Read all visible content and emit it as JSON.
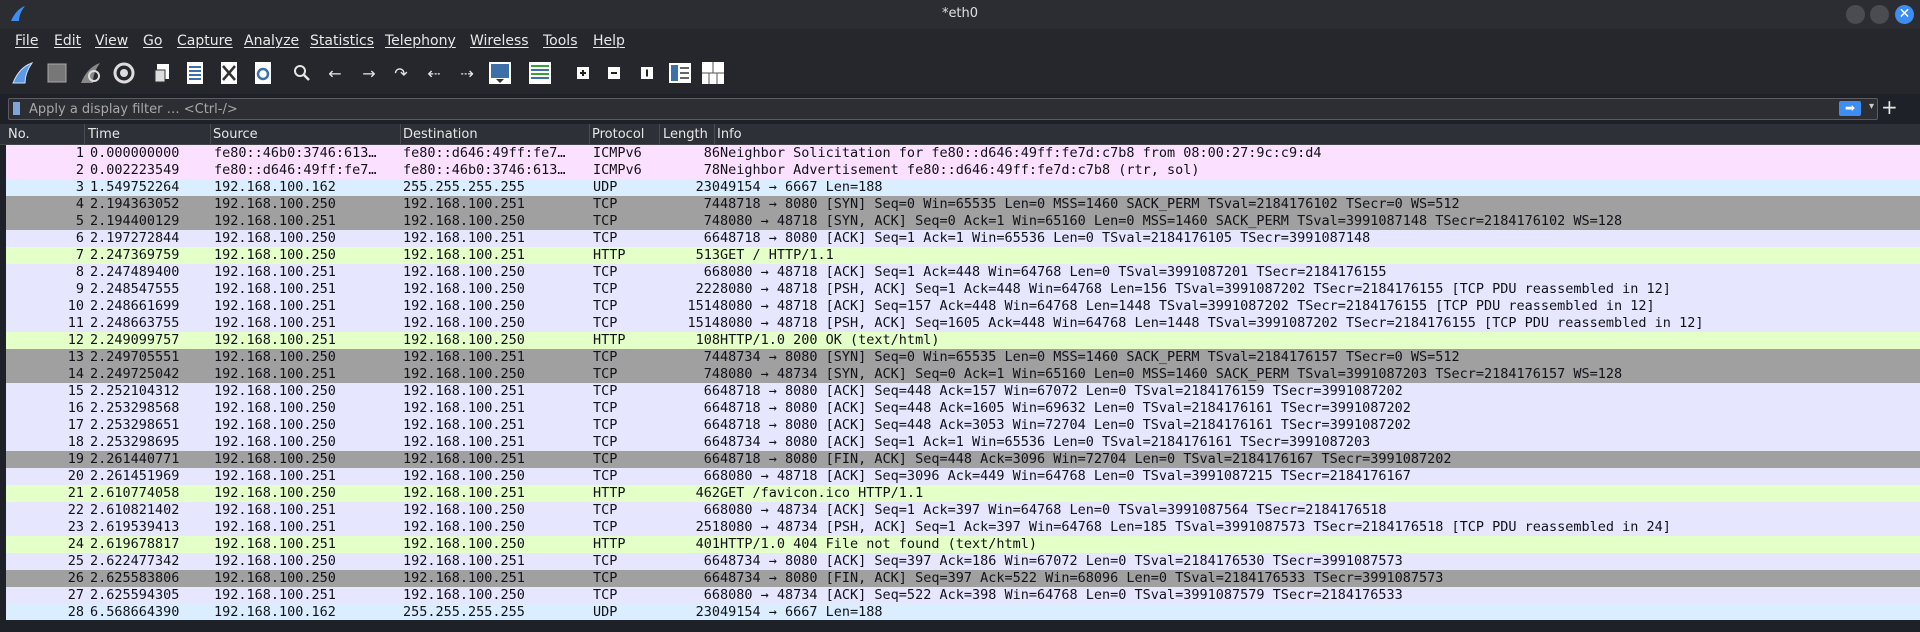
{
  "window": {
    "title": "*eth0"
  },
  "menu": [
    "File",
    "Edit",
    "View",
    "Go",
    "Capture",
    "Analyze",
    "Statistics",
    "Telephony",
    "Wireless",
    "Tools",
    "Help"
  ],
  "filter": {
    "placeholder": "Apply a display filter … <Ctrl-/>"
  },
  "columns": [
    "No.",
    "Time",
    "Source",
    "Destination",
    "Protocol",
    "Length",
    "Info"
  ],
  "colors": {
    "icmpv6": "#fce0ff",
    "udp": "#daeeff",
    "tcp": "#e7e6ff",
    "tcp_syn_fin": "#a0a0a0",
    "http": "#e4ffc7",
    "accent": "#3d8ef0"
  },
  "packets": [
    {
      "no": "1",
      "time": "0.000000000",
      "src": "fe80::46b0:3746:613…",
      "dst": "fe80::d646:49ff:fe7…",
      "proto": "ICMPv6",
      "len": "86",
      "info": "Neighbor Solicitation for fe80::d646:49ff:fe7d:c7b8 from 08:00:27:9c:c9:d4",
      "color": "#fce0ff"
    },
    {
      "no": "2",
      "time": "0.002223549",
      "src": "fe80::d646:49ff:fe7…",
      "dst": "fe80::46b0:3746:613…",
      "proto": "ICMPv6",
      "len": "78",
      "info": "Neighbor Advertisement fe80::d646:49ff:fe7d:c7b8 (rtr, sol)",
      "color": "#fce0ff"
    },
    {
      "no": "3",
      "time": "1.549752264",
      "src": "192.168.100.162",
      "dst": "255.255.255.255",
      "proto": "UDP",
      "len": "230",
      "info": "49154 → 6667 Len=188",
      "color": "#daeeff"
    },
    {
      "no": "4",
      "time": "2.194363052",
      "src": "192.168.100.250",
      "dst": "192.168.100.251",
      "proto": "TCP",
      "len": "74",
      "info": "48718 → 8080 [SYN] Seq=0 Win=65535 Len=0 MSS=1460 SACK_PERM TSval=2184176102 TSecr=0 WS=512",
      "color": "#a0a0a0"
    },
    {
      "no": "5",
      "time": "2.194400129",
      "src": "192.168.100.251",
      "dst": "192.168.100.250",
      "proto": "TCP",
      "len": "74",
      "info": "8080 → 48718 [SYN, ACK] Seq=0 Ack=1 Win=65160 Len=0 MSS=1460 SACK_PERM TSval=3991087148 TSecr=2184176102 WS=128",
      "color": "#a0a0a0"
    },
    {
      "no": "6",
      "time": "2.197272844",
      "src": "192.168.100.250",
      "dst": "192.168.100.251",
      "proto": "TCP",
      "len": "66",
      "info": "48718 → 8080 [ACK] Seq=1 Ack=1 Win=65536 Len=0 TSval=2184176105 TSecr=3991087148",
      "color": "#e7e6ff"
    },
    {
      "no": "7",
      "time": "2.247369759",
      "src": "192.168.100.250",
      "dst": "192.168.100.251",
      "proto": "HTTP",
      "len": "513",
      "info": "GET / HTTP/1.1",
      "color": "#e4ffc7"
    },
    {
      "no": "8",
      "time": "2.247489400",
      "src": "192.168.100.251",
      "dst": "192.168.100.250",
      "proto": "TCP",
      "len": "66",
      "info": "8080 → 48718 [ACK] Seq=1 Ack=448 Win=64768 Len=0 TSval=3991087201 TSecr=2184176155",
      "color": "#e7e6ff"
    },
    {
      "no": "9",
      "time": "2.248547555",
      "src": "192.168.100.251",
      "dst": "192.168.100.250",
      "proto": "TCP",
      "len": "222",
      "info": "8080 → 48718 [PSH, ACK] Seq=1 Ack=448 Win=64768 Len=156 TSval=3991087202 TSecr=2184176155 [TCP PDU reassembled in 12]",
      "color": "#e7e6ff"
    },
    {
      "no": "10",
      "time": "2.248661699",
      "src": "192.168.100.251",
      "dst": "192.168.100.250",
      "proto": "TCP",
      "len": "1514",
      "info": "8080 → 48718 [ACK] Seq=157 Ack=448 Win=64768 Len=1448 TSval=3991087202 TSecr=2184176155 [TCP PDU reassembled in 12]",
      "color": "#e7e6ff"
    },
    {
      "no": "11",
      "time": "2.248663755",
      "src": "192.168.100.251",
      "dst": "192.168.100.250",
      "proto": "TCP",
      "len": "1514",
      "info": "8080 → 48718 [PSH, ACK] Seq=1605 Ack=448 Win=64768 Len=1448 TSval=3991087202 TSecr=2184176155 [TCP PDU reassembled in 12]",
      "color": "#e7e6ff"
    },
    {
      "no": "12",
      "time": "2.249099757",
      "src": "192.168.100.251",
      "dst": "192.168.100.250",
      "proto": "HTTP",
      "len": "108",
      "info": "HTTP/1.0 200 OK  (text/html)",
      "color": "#e4ffc7"
    },
    {
      "no": "13",
      "time": "2.249705551",
      "src": "192.168.100.250",
      "dst": "192.168.100.251",
      "proto": "TCP",
      "len": "74",
      "info": "48734 → 8080 [SYN] Seq=0 Win=65535 Len=0 MSS=1460 SACK_PERM TSval=2184176157 TSecr=0 WS=512",
      "color": "#a0a0a0"
    },
    {
      "no": "14",
      "time": "2.249725042",
      "src": "192.168.100.251",
      "dst": "192.168.100.250",
      "proto": "TCP",
      "len": "74",
      "info": "8080 → 48734 [SYN, ACK] Seq=0 Ack=1 Win=65160 Len=0 MSS=1460 SACK_PERM TSval=3991087203 TSecr=2184176157 WS=128",
      "color": "#a0a0a0"
    },
    {
      "no": "15",
      "time": "2.252104312",
      "src": "192.168.100.250",
      "dst": "192.168.100.251",
      "proto": "TCP",
      "len": "66",
      "info": "48718 → 8080 [ACK] Seq=448 Ack=157 Win=67072 Len=0 TSval=2184176159 TSecr=3991087202",
      "color": "#e7e6ff"
    },
    {
      "no": "16",
      "time": "2.253298568",
      "src": "192.168.100.250",
      "dst": "192.168.100.251",
      "proto": "TCP",
      "len": "66",
      "info": "48718 → 8080 [ACK] Seq=448 Ack=1605 Win=69632 Len=0 TSval=2184176161 TSecr=3991087202",
      "color": "#e7e6ff"
    },
    {
      "no": "17",
      "time": "2.253298651",
      "src": "192.168.100.250",
      "dst": "192.168.100.251",
      "proto": "TCP",
      "len": "66",
      "info": "48718 → 8080 [ACK] Seq=448 Ack=3053 Win=72704 Len=0 TSval=2184176161 TSecr=3991087202",
      "color": "#e7e6ff"
    },
    {
      "no": "18",
      "time": "2.253298695",
      "src": "192.168.100.250",
      "dst": "192.168.100.251",
      "proto": "TCP",
      "len": "66",
      "info": "48734 → 8080 [ACK] Seq=1 Ack=1 Win=65536 Len=0 TSval=2184176161 TSecr=3991087203",
      "color": "#e7e6ff"
    },
    {
      "no": "19",
      "time": "2.261440771",
      "src": "192.168.100.250",
      "dst": "192.168.100.251",
      "proto": "TCP",
      "len": "66",
      "info": "48718 → 8080 [FIN, ACK] Seq=448 Ack=3096 Win=72704 Len=0 TSval=2184176167 TSecr=3991087202",
      "color": "#a0a0a0"
    },
    {
      "no": "20",
      "time": "2.261451969",
      "src": "192.168.100.251",
      "dst": "192.168.100.250",
      "proto": "TCP",
      "len": "66",
      "info": "8080 → 48718 [ACK] Seq=3096 Ack=449 Win=64768 Len=0 TSval=3991087215 TSecr=2184176167",
      "color": "#e7e6ff"
    },
    {
      "no": "21",
      "time": "2.610774058",
      "src": "192.168.100.250",
      "dst": "192.168.100.251",
      "proto": "HTTP",
      "len": "462",
      "info": "GET /favicon.ico HTTP/1.1",
      "color": "#e4ffc7"
    },
    {
      "no": "22",
      "time": "2.610821402",
      "src": "192.168.100.251",
      "dst": "192.168.100.250",
      "proto": "TCP",
      "len": "66",
      "info": "8080 → 48734 [ACK] Seq=1 Ack=397 Win=64768 Len=0 TSval=3991087564 TSecr=2184176518",
      "color": "#e7e6ff"
    },
    {
      "no": "23",
      "time": "2.619539413",
      "src": "192.168.100.251",
      "dst": "192.168.100.250",
      "proto": "TCP",
      "len": "251",
      "info": "8080 → 48734 [PSH, ACK] Seq=1 Ack=397 Win=64768 Len=185 TSval=3991087573 TSecr=2184176518 [TCP PDU reassembled in 24]",
      "color": "#e7e6ff"
    },
    {
      "no": "24",
      "time": "2.619678817",
      "src": "192.168.100.251",
      "dst": "192.168.100.250",
      "proto": "HTTP",
      "len": "401",
      "info": "HTTP/1.0 404 File not found  (text/html)",
      "color": "#e4ffc7"
    },
    {
      "no": "25",
      "time": "2.622477342",
      "src": "192.168.100.250",
      "dst": "192.168.100.251",
      "proto": "TCP",
      "len": "66",
      "info": "48734 → 8080 [ACK] Seq=397 Ack=186 Win=67072 Len=0 TSval=2184176530 TSecr=3991087573",
      "color": "#e7e6ff"
    },
    {
      "no": "26",
      "time": "2.625583806",
      "src": "192.168.100.250",
      "dst": "192.168.100.251",
      "proto": "TCP",
      "len": "66",
      "info": "48734 → 8080 [FIN, ACK] Seq=397 Ack=522 Win=68096 Len=0 TSval=2184176533 TSecr=3991087573",
      "color": "#a0a0a0"
    },
    {
      "no": "27",
      "time": "2.625594305",
      "src": "192.168.100.251",
      "dst": "192.168.100.250",
      "proto": "TCP",
      "len": "66",
      "info": "8080 → 48734 [ACK] Seq=522 Ack=398 Win=64768 Len=0 TSval=3991087579 TSecr=2184176533",
      "color": "#e7e6ff"
    },
    {
      "no": "28",
      "time": "6.568664390",
      "src": "192.168.100.162",
      "dst": "255.255.255.255",
      "proto": "UDP",
      "len": "230",
      "info": "49154 → 6667 Len=188",
      "color": "#daeeff"
    }
  ]
}
